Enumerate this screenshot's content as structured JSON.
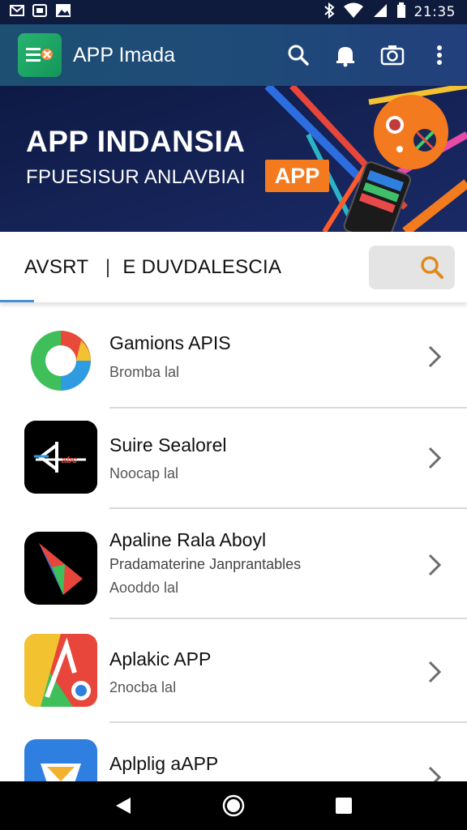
{
  "status_bar": {
    "time": "21:35",
    "left_icons": [
      "mail-icon",
      "sim-icon",
      "image-icon"
    ],
    "right_icons": [
      "bluetooth-icon",
      "wifi-icon",
      "signal-icon",
      "battery-icon"
    ]
  },
  "app_bar": {
    "title": "APP Imada",
    "actions": [
      "search-icon",
      "notification-icon",
      "camera-icon",
      "more-vert-icon"
    ]
  },
  "banner": {
    "title": "APP INDANSIA",
    "subtitle": "FPUESISUR ANLAVBIAI",
    "badge": "APP"
  },
  "tabs": {
    "label_left": "AVSRT",
    "separator": "|",
    "label_right": "E DUVDALESCIA"
  },
  "apps": [
    {
      "name": "Gamions APIS",
      "line2": "",
      "meta": "Bromba lal"
    },
    {
      "name": "Suire Sealorel",
      "line2": "",
      "meta": "Noocap lal"
    },
    {
      "name": "Apaline Rala Aboyl",
      "line2": "Pradamaterine Janprantables",
      "meta": "Aooddo lal"
    },
    {
      "name": "Aplakic APP",
      "line2": "",
      "meta": "2nocba lal"
    },
    {
      "name": "Aplplig aAPP",
      "line2": "",
      "meta": ""
    }
  ],
  "colors": {
    "status_bar": "#0f1b3d",
    "app_bar": "#1e4a78",
    "banner_bg": "#101b45",
    "badge": "#f47a1f",
    "search_icon": "#e08a1e",
    "tab_indicator": "#4a90d9"
  },
  "nav": [
    "back-icon",
    "home-icon",
    "recents-icon"
  ]
}
